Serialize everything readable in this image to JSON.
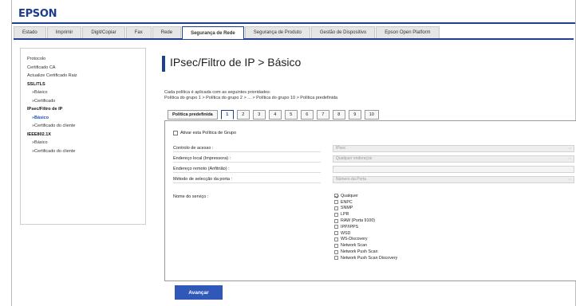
{
  "brand": "EPSON",
  "tabs": [
    {
      "label": "Estado"
    },
    {
      "label": "Imprimir"
    },
    {
      "label": "Digit/Copiar"
    },
    {
      "label": "Fax"
    },
    {
      "label": "Rede"
    },
    {
      "label": "Segurança de Rede"
    },
    {
      "label": "Segurança de Produto"
    },
    {
      "label": "Gestão de Dispositivo"
    },
    {
      "label": "Epson Open Platform"
    }
  ],
  "active_tab": "Segurança de Rede",
  "sidebar": {
    "items": [
      {
        "label": "Protocolo"
      },
      {
        "label": "Certificado CA"
      },
      {
        "label": "Actualize Certificado Raiz"
      },
      {
        "label": "SSL/TLS"
      },
      {
        "label": "»Básico"
      },
      {
        "label": "»Certificado"
      },
      {
        "label": "IPsec/Filtro de IP"
      },
      {
        "label": "»Básico"
      },
      {
        "label": "»Certificado do cliente"
      },
      {
        "label": "IEEE802.1X"
      },
      {
        "label": "»Básico"
      },
      {
        "label": "»Certificado do cliente"
      }
    ]
  },
  "page_title": "IPsec/Filtro de IP > Básico",
  "description": {
    "line1": "Cada política é aplicada com as seguintes prioridades:",
    "line2": "Política do grupo 1 > Política do grupo 2 > ... > Política do grupo 10 > Política predefinida"
  },
  "group_tabs": [
    "Política predefinida",
    "1",
    "2",
    "3",
    "4",
    "5",
    "6",
    "7",
    "8",
    "9",
    "10"
  ],
  "active_group_tab": "1",
  "form": {
    "enable_label": "Ativar esta Política de Grupo",
    "rows": [
      {
        "label": "Controlo de acesso :",
        "value": "IPsec"
      },
      {
        "label": "Endereço local (Impressora) :",
        "value": "Qualquer endereços"
      },
      {
        "label": "Endereço remoto (Anfitrião) :",
        "value": ""
      },
      {
        "label": "Método de selecção da porta :",
        "value": "Número da Porta"
      }
    ],
    "service_label": "Nome do serviço :",
    "services": [
      {
        "label": "Qualquer",
        "checked": true
      },
      {
        "label": "ENPC",
        "checked": false
      },
      {
        "label": "SNMP",
        "checked": false
      },
      {
        "label": "LPR",
        "checked": false
      },
      {
        "label": "RAW (Porta 9100)",
        "checked": false
      },
      {
        "label": "IPP/IPPS",
        "checked": false
      },
      {
        "label": "WSD",
        "checked": false
      },
      {
        "label": "WS-Discovery",
        "checked": false
      },
      {
        "label": "Network Scan",
        "checked": false
      },
      {
        "label": "Network Push Scan",
        "checked": false
      },
      {
        "label": "Network Push Scan Discovery",
        "checked": false
      }
    ]
  },
  "submit_label": "Avançar",
  "colors": {
    "brand": "#1d3c8f",
    "accent": "#1f3f93",
    "button": "#2f58b8",
    "selected_link": "#1f4fbf"
  }
}
